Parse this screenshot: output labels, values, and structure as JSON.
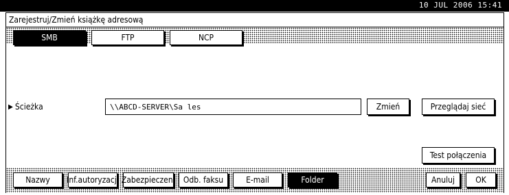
{
  "status_bar": {
    "datetime": "10 JUL  2006 15:41"
  },
  "title": "Zarejestruj/Zmień książkę adresową",
  "protocol_tabs": [
    {
      "label": "SMB",
      "selected": true
    },
    {
      "label": "FTP",
      "selected": false
    },
    {
      "label": "NCP",
      "selected": false
    }
  ],
  "path": {
    "label": "Ścieżka",
    "value": "\\\\ABCD-SERVER\\Sa les",
    "change_button": "Zmień",
    "browse_button": "Przeglądaj sieć"
  },
  "test_connection_button": "Test połączenia",
  "bottom_tabs": [
    {
      "label": "Nazwy",
      "selected": false
    },
    {
      "label": "Inf.autoryzacji",
      "selected": false
    },
    {
      "label": "Zabezpieczen.",
      "selected": false
    },
    {
      "label": "Odb. faksu",
      "selected": false
    },
    {
      "label": "E-mail",
      "selected": false
    },
    {
      "label": "Folder",
      "selected": true
    }
  ],
  "actions": {
    "cancel": "Anuluj",
    "ok": "OK"
  }
}
